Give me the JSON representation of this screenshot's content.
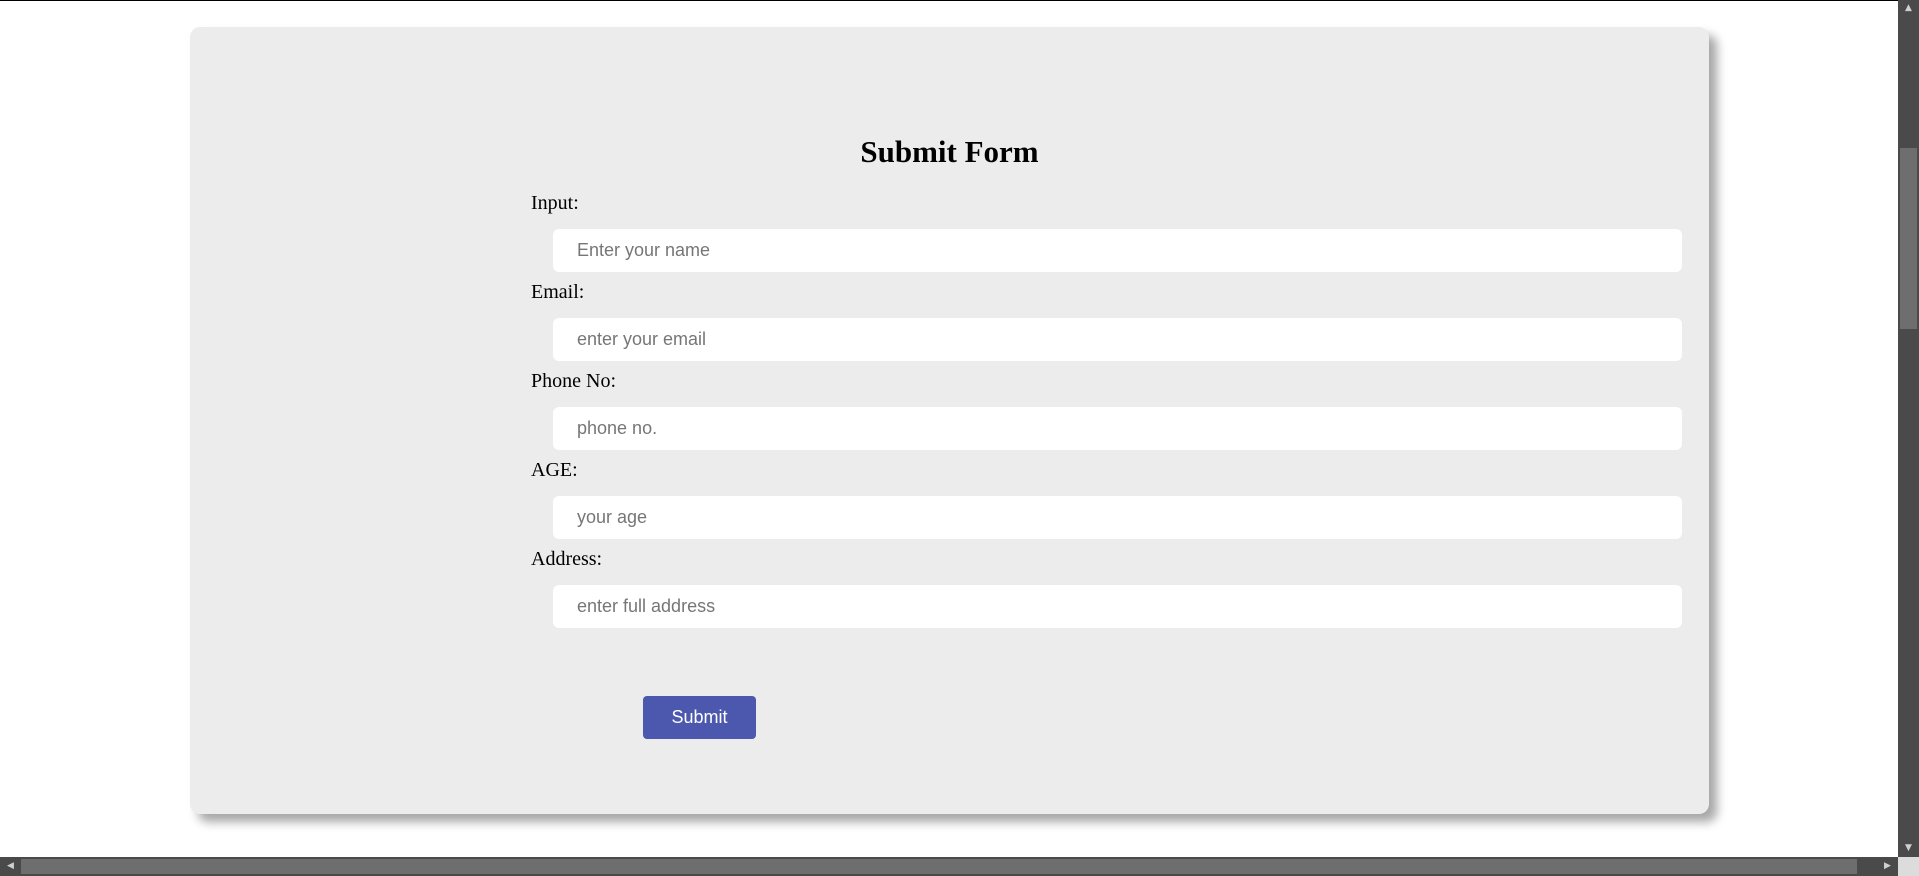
{
  "form": {
    "title": "Submit Form",
    "fields": [
      {
        "label": "Input:",
        "placeholder": "Enter your name",
        "value": ""
      },
      {
        "label": "Email:",
        "placeholder": "enter your email",
        "value": ""
      },
      {
        "label": "Phone No:",
        "placeholder": "phone no.",
        "value": ""
      },
      {
        "label": "AGE:",
        "placeholder": "your age",
        "value": ""
      },
      {
        "label": "Address:",
        "placeholder": "enter full address",
        "value": ""
      }
    ],
    "submit_label": "Submit"
  },
  "colors": {
    "card_background": "#ececec",
    "submit_background": "#4c58ad",
    "page_background": "#ffffff"
  },
  "scrollbars": {
    "up_icon": "arrow-up-icon",
    "down_icon": "arrow-down-icon",
    "left_icon": "arrow-left-icon",
    "right_icon": "arrow-right-icon"
  }
}
